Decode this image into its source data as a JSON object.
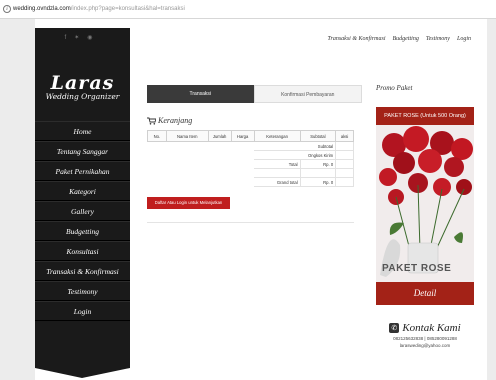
{
  "browser": {
    "url_host": "wedding.ovndzla.com",
    "url_path": "/index.php?page=konsultasi&hal=transaksi"
  },
  "sidebar": {
    "social_icons": [
      "f",
      "✶",
      "◉"
    ],
    "logo_title": "Laras",
    "logo_subtitle": "Wedding Organizer",
    "menu": [
      {
        "label": "Home"
      },
      {
        "label": "Tentang Sanggar"
      },
      {
        "label": "Paket Pernikahan"
      },
      {
        "label": "Kategori"
      },
      {
        "label": "Gallery"
      },
      {
        "label": "Budgetting"
      },
      {
        "label": "Konsultasi"
      },
      {
        "label": "Transaksi & Konfirmasi"
      },
      {
        "label": "Testimony"
      },
      {
        "label": "Login"
      }
    ]
  },
  "topnav": [
    "Transaksi & Konfirmasi",
    "Budgetting",
    "Testimony",
    "Login"
  ],
  "tabs": [
    {
      "label": "Transaksi",
      "active": true
    },
    {
      "label": "Konfirmasi Pembayaran",
      "active": false
    }
  ],
  "cart": {
    "title": "Keranjang",
    "columns": [
      "No.",
      "Nama Item",
      "Jumlah",
      "Harga",
      "Keterangan",
      "Subtotal",
      "aksi"
    ],
    "summary": [
      {
        "label": "Subtotal",
        "value": ""
      },
      {
        "label": "Ongkos Kirim",
        "value": ""
      },
      {
        "label": "Total",
        "value": "Rp. 0"
      },
      {
        "label": "",
        "value": ""
      },
      {
        "label": "Grand total",
        "value": "Rp. 0"
      }
    ],
    "login_button": "Daftar Atau Login untuk Melanjutkan"
  },
  "promo": {
    "title": "Promo Paket",
    "card_header": "PAKET ROSE (Untuk 500 Orang)",
    "card_name": "PAKET ROSE",
    "detail_label": "Detail"
  },
  "kontak": {
    "title": "Kontak Kami",
    "phones": "082125632838 | 085280091288",
    "email": "larasweding@yahoo.com"
  },
  "colors": {
    "accent": "#c01e1e",
    "sidebar_bg": "#1a1a1a",
    "promo_red": "#a32217"
  }
}
